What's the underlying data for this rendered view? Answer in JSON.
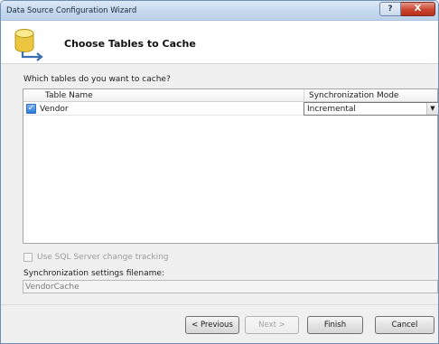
{
  "window": {
    "title": "Data Source Configuration Wizard",
    "help_label": "?",
    "close_label": "X"
  },
  "header": {
    "title": "Choose Tables to Cache",
    "icon": "database-icon"
  },
  "main": {
    "question": "Which tables do you want to cache?",
    "columns": [
      "Table Name",
      "Synchronization Mode"
    ],
    "rows": [
      {
        "checked": true,
        "name": "Vendor",
        "sync_mode": "Incremental"
      }
    ],
    "sql_tracking_label": "Use SQL Server change tracking",
    "sql_tracking_checked": false,
    "filename_label": "Synchronization settings filename:",
    "filename_value": "VendorCache"
  },
  "buttons": {
    "previous": "< Previous",
    "next": "Next >",
    "finish": "Finish",
    "cancel": "Cancel"
  },
  "colors": {
    "accent": "#2b79d6",
    "close": "#c9442f"
  }
}
